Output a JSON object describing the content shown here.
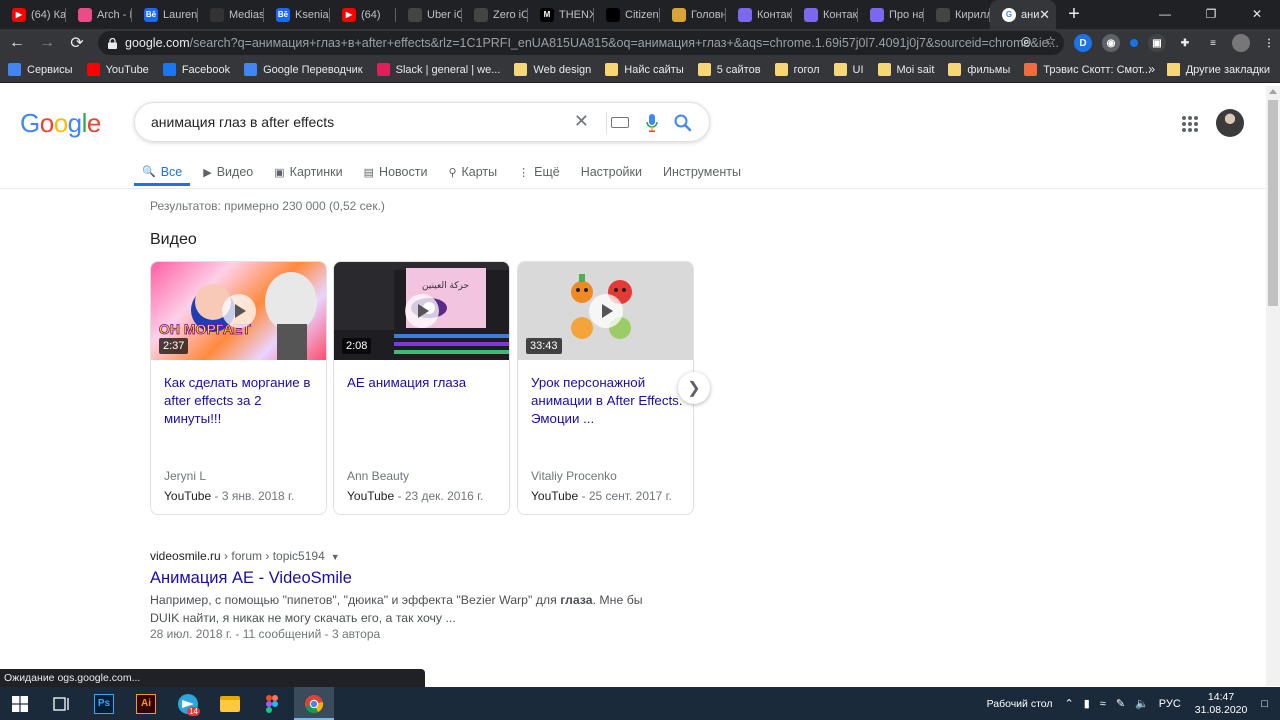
{
  "browser": {
    "tabs": [
      {
        "title": "(64) Ка",
        "icon": "youtube-icon",
        "color": "#ff0000"
      },
      {
        "title": "Arch - I",
        "icon": "dribbble-icon",
        "color": "#ea4c89"
      },
      {
        "title": "Laurent",
        "icon": "behance-icon",
        "color": "#1769ff"
      },
      {
        "title": "Mediasp",
        "icon": "x-icon",
        "color": "#333333"
      },
      {
        "title": "Ksenia I",
        "icon": "behance-icon",
        "color": "#1769ff"
      },
      {
        "title": "(64)",
        "icon": "youtube-icon",
        "color": "#ff0000"
      },
      {
        "title": "Uber iO",
        "icon": "generic-icon",
        "color": "#444444"
      },
      {
        "title": "Zero iO",
        "icon": "generic-icon",
        "color": "#444444"
      },
      {
        "title": "THENX",
        "icon": "medium-icon",
        "color": "#000000"
      },
      {
        "title": "Citizen",
        "icon": "citizen-icon",
        "color": "#000000"
      },
      {
        "title": "Головн",
        "icon": "site-icon",
        "color": "#d8a43a"
      },
      {
        "title": "Контак",
        "icon": "site-icon",
        "color": "#7b68ee"
      },
      {
        "title": "Контак",
        "icon": "site-icon",
        "color": "#7b68ee"
      },
      {
        "title": "Про на",
        "icon": "site-icon",
        "color": "#7b68ee"
      },
      {
        "title": "Кирилл",
        "icon": "site-icon",
        "color": "#444444"
      },
      {
        "title": "ани",
        "icon": "google-icon",
        "color": "#ffffff",
        "active": true
      }
    ],
    "url_host": "google.com",
    "url_rest": "/search?q=анимация+глаз+в+after+effects&rlz=1C1PRFI_enUA815UA815&oq=анимация+глаз+&aqs=chrome.1.69i57j0l7.4091j0j7&sourceid=chrome&ie...",
    "bookmarks": [
      {
        "label": "Сервисы",
        "type": "apps"
      },
      {
        "label": "YouTube",
        "type": "youtube"
      },
      {
        "label": "Facebook",
        "type": "facebook"
      },
      {
        "label": "Google Переводчик",
        "type": "translate"
      },
      {
        "label": "Slack | general | we...",
        "type": "slack"
      },
      {
        "label": "Web design",
        "type": "folder"
      },
      {
        "label": "Найс сайты",
        "type": "folder"
      },
      {
        "label": "5 сайтов",
        "type": "folder"
      },
      {
        "label": "гогол",
        "type": "folder"
      },
      {
        "label": "UI",
        "type": "folder"
      },
      {
        "label": "Moi sait",
        "type": "folder"
      },
      {
        "label": "фильмы",
        "type": "folder"
      },
      {
        "label": "Трэвис Скотт: Смот...",
        "type": "page"
      }
    ],
    "other_bookmarks": "Другие закладки",
    "status": "Ожидание ogs.google.com..."
  },
  "google": {
    "logo": "Google",
    "query": "анимация глаз в after effects",
    "nav": [
      "Все",
      "Видео",
      "Картинки",
      "Новости",
      "Карты",
      "Ещё",
      "Настройки",
      "Инструменты"
    ],
    "stats": "Результатов: примерно 230 000 (0,52 сек.)",
    "videos_heading": "Видео",
    "videos": [
      {
        "title": "Как сделать моргание в after effects за 2 минуты!!!",
        "duration": "2:37",
        "channel": "Jeryni L",
        "source": "YouTube",
        "date": "3 янв. 2018 г."
      },
      {
        "title": "AE анимация глаза",
        "duration": "2:08",
        "channel": "Ann Beauty",
        "source": "YouTube",
        "date": "23 дек. 2016 г."
      },
      {
        "title": "Урок персонажной анимации в After Effects. Эмоции ...",
        "duration": "33:43",
        "channel": "Vitaliy Procenko",
        "source": "YouTube",
        "date": "25 сент. 2017 г."
      }
    ],
    "result": {
      "site": "videosmile.ru",
      "path": " › forum › topic5194",
      "title": "Анимация AE - VideoSmile",
      "snippet_a": "Например, с помощью \"пипетов\", \"дюика\" и эффекта \"Bezier Warp\" для ",
      "snippet_b": "глаза",
      "snippet_c": ". Мне бы DUIK найти, я никак не могу скачать его, а так хочу ...",
      "meta": "28 июл. 2018 г. - 11 сообщений - 3 автора"
    }
  },
  "taskbar": {
    "desktop_label": "Рабочий стол",
    "lang": "РУС",
    "time": "14:47",
    "date": "31.08.2020",
    "telegram_badge": "14"
  }
}
